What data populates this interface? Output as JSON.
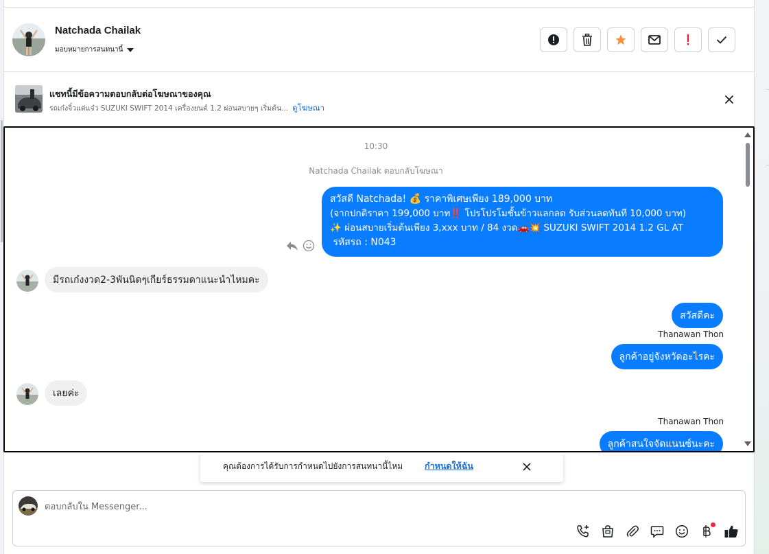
{
  "header": {
    "contact_name": "Natchada Chailak",
    "assign_label": "มอบหมายการสนทนานี้"
  },
  "ad_banner": {
    "title": "แชทนี้มีข้อความตอบกลับต่อโฆษณาของคุณ",
    "description": "รถเก๋งจิ๋วแต่แจ๋ว SUZUKI SWIFT 2014 เครื่องยนต์ 1.2 ผ่อนสบายๆ เริ่มต้น...",
    "link_label": "ดูโฆษณา"
  },
  "conversation": {
    "timestamp": "10:30",
    "ad_reply_note": "Natchada Chailak ตอบกลับโฆษณา",
    "ad_message_lines": [
      "สวัสดี Natchada! 💰 ราคาพิเศษเพียง 189,000 บาท",
      "(จากปกติราคา 199,000 บาท‼️ โปรโปรโมชั้นข้าวแลกลด รับส่วนลดทันที 10,000 บาท)",
      "✨ ผ่อนสบายเริ่มต้นเพียง 3,xxx บาท / 84 งวด🚗💥 SUZUKI SWIFT 2014 1.2 GL AT",
      " รหัสรถ : N043"
    ],
    "incoming_1": "มีรถเก๋งงวด2-3พันนิดๆเกียร์ธรรมดาแนะนำไหมคะ",
    "outgoing_1": "สวัสดีคะ",
    "sender_1": "Thanawan Thon",
    "outgoing_2": "ลูกค้าอยู่จังหวัดอะไรคะ",
    "incoming_2": "เลยค่ะ",
    "sender_2": "Thanawan Thon",
    "outgoing_3": "ลูกค้าสนใจจัดแนนซ์นะคะ"
  },
  "toast": {
    "text": "คุณต้องการได้รับการกำหนดไปยังการสนทนานี้ไหม",
    "link_label": "กำหนดให้ฉัน"
  },
  "composer": {
    "placeholder": "ตอบกลับใน Messenger..."
  },
  "colors": {
    "outgoing_bubble": "#0a7cff",
    "incoming_bubble": "#f0f0f0",
    "link": "#1a6ed8",
    "star": "#f7923b",
    "alert": "#e41e3f"
  }
}
